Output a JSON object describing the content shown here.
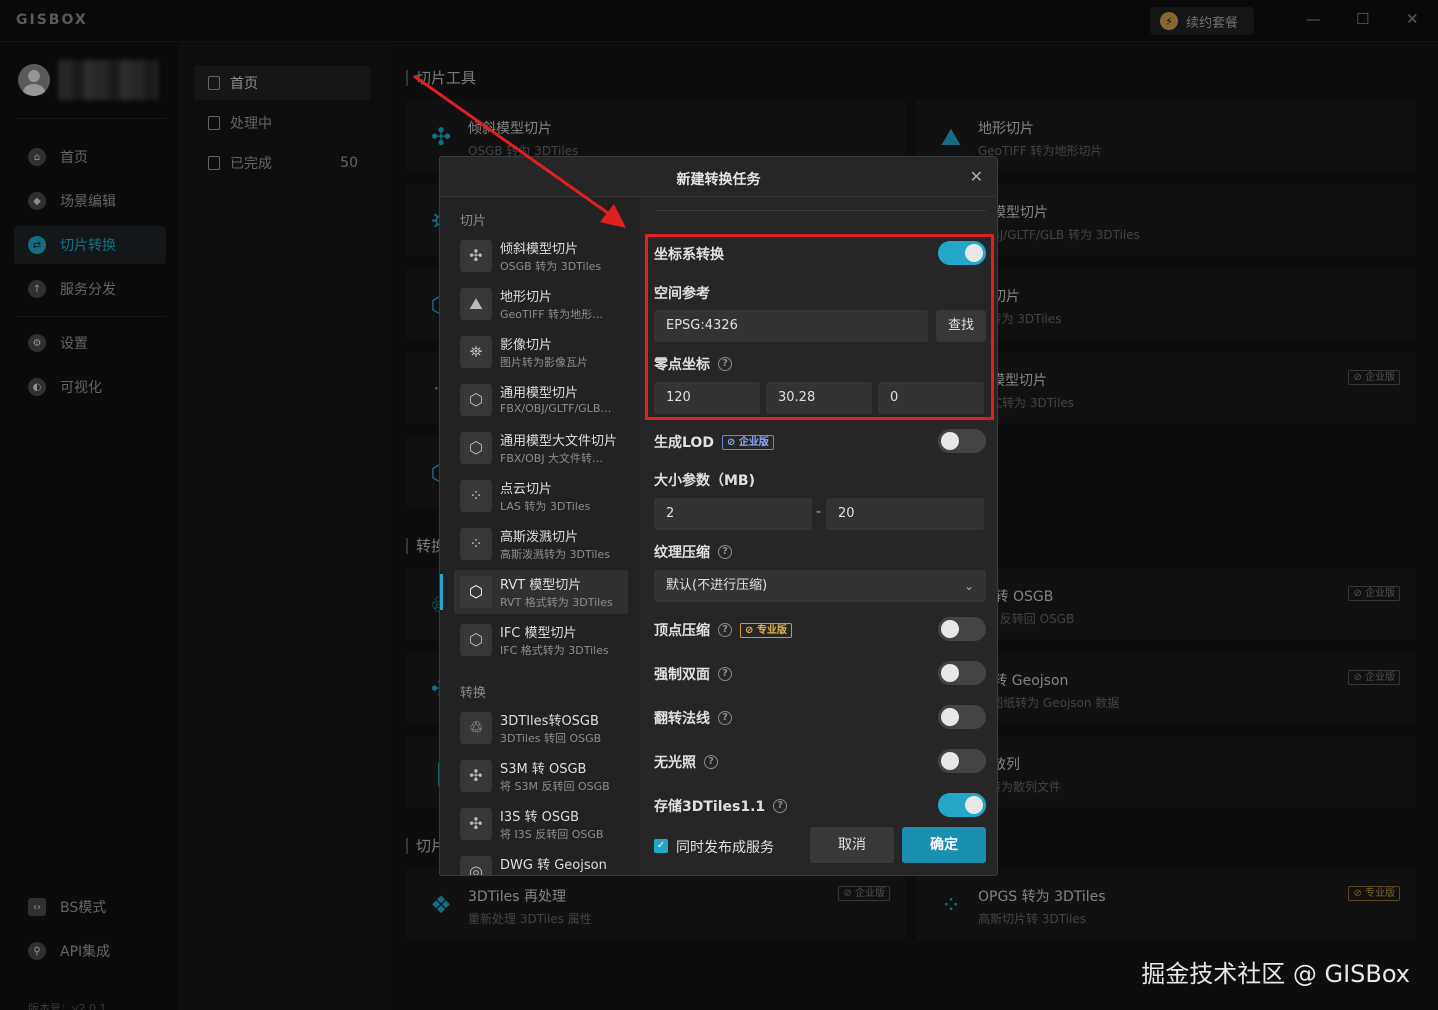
{
  "app": {
    "logo": "GISBOX",
    "renew_label": "续约套餐",
    "min_glyph": "—",
    "max_glyph": "☐",
    "close_glyph": "✕"
  },
  "sidebar": {
    "items": [
      {
        "label": "首页",
        "icon": "home-icon"
      },
      {
        "label": "场景编辑",
        "icon": "cube-icon"
      },
      {
        "label": "切片转换",
        "icon": "convert-icon"
      },
      {
        "label": "服务分发",
        "icon": "upload-icon"
      },
      {
        "label": "设置",
        "icon": "gear-icon"
      },
      {
        "label": "可视化",
        "icon": "chart-icon"
      }
    ],
    "bottom": [
      {
        "label": "BS模式",
        "icon": "code-icon"
      },
      {
        "label": "API集成",
        "icon": "api-icon"
      }
    ],
    "version": "版本号：v2.0.1"
  },
  "subbar": {
    "items": [
      {
        "label": "首页"
      },
      {
        "label": "处理中"
      },
      {
        "label": "已完成",
        "count": "50"
      }
    ]
  },
  "main": {
    "section_slice": "切片工具",
    "section_convert": "转换",
    "section_slice2": "切片",
    "cards": [
      {
        "title": "倾斜模型切片",
        "sub": "OSGB 转为 3DTiles",
        "badge": ""
      },
      {
        "title": "地形切片",
        "sub": "GeoTIFF 转为地形切片",
        "badge": ""
      },
      {
        "title": "用模型切片",
        "sub": "/OBJ/GLTF/GLB 转为 3DTiles",
        "badge": ""
      },
      {
        "title": "云切片",
        "sub": "5 转为 3DTiles",
        "badge": ""
      },
      {
        "title": "T 模型切片",
        "sub": "格式转为 3DTiles",
        "badge": "企业版"
      },
      {
        "title": "M 转 OSGB",
        "sub": "3M 反转回 OSGB",
        "badge": "企业版"
      },
      {
        "title": "G 转 Geojson",
        "sub": "G 图纸转为 Geojson 数据",
        "badge": "企业版"
      },
      {
        "title": "转散列",
        "sub": "P 转为散列文件",
        "badge": ""
      },
      {
        "title": "3DTiles 再处理",
        "sub": "重新处理 3DTiles 属性",
        "badge": "企业版"
      },
      {
        "title": "OPGS 转为 3DTiles",
        "sub": "高斯切片转 3DTiles",
        "badge": "专业版"
      }
    ]
  },
  "dialog": {
    "title": "新建转换任务",
    "group_slice": "切片",
    "group_convert": "转换",
    "tasks": [
      {
        "title": "倾斜模型切片",
        "sub": "OSGB 转为 3DTiles",
        "icon": "drone-icon"
      },
      {
        "title": "地形切片",
        "sub": "GeoTIFF 转为地形…",
        "icon": "terrain-icon"
      },
      {
        "title": "影像切片",
        "sub": "图片转为影像瓦片",
        "icon": "satellite-icon"
      },
      {
        "title": "通用模型切片",
        "sub": "FBX/OBJ/GLTF/GLB…",
        "icon": "box-icon"
      },
      {
        "title": "通用模型大文件切片",
        "sub": "FBX/OBJ 大文件转…",
        "icon": "box-icon"
      },
      {
        "title": "点云切片",
        "sub": "LAS 转为 3DTiles",
        "icon": "pointcloud-icon"
      },
      {
        "title": "高斯泼溅切片",
        "sub": "高斯泼溅转为 3DTiles",
        "icon": "pointcloud-icon"
      },
      {
        "title": "RVT 模型切片",
        "sub": "RVT 格式转为 3DTiles",
        "icon": "box-icon"
      },
      {
        "title": "IFC 模型切片",
        "sub": "IFC 格式转为 3DTiles",
        "icon": "box-icon"
      }
    ],
    "convert_tasks": [
      {
        "title": "3DTIles转OSGB",
        "sub": "3DTiles 转回 OSGB",
        "icon": "recycle-icon"
      },
      {
        "title": "S3M 转 OSGB",
        "sub": "将 S3M 反转回 OSGB",
        "icon": "drone-icon"
      },
      {
        "title": "I3S 转 OSGB",
        "sub": "将 I3S 反转回 OSGB",
        "icon": "drone-icon"
      },
      {
        "title": "DWG 转 Geojson",
        "sub": "",
        "icon": "globe-icon"
      }
    ],
    "form": {
      "coord_label": "坐标系转换",
      "coord_on": true,
      "spatial_ref_label": "空间参考",
      "spatial_ref_value": "EPSG:4326",
      "find_label": "查找",
      "origin_label": "零点坐标",
      "origin_x": "120",
      "origin_y": "30.28",
      "origin_z": "0",
      "lod_label": "生成LOD",
      "lod_badge": "企业版",
      "lod_on": false,
      "size_label": "大小参数（MB)",
      "size_min": "2",
      "size_dash": "-",
      "size_max": "20",
      "texture_label": "纹理压缩",
      "texture_value": "默认(不进行压缩)",
      "vertex_label": "顶点压缩",
      "vertex_badge": "专业版",
      "vertex_on": false,
      "double_label": "强制双面",
      "double_on": false,
      "normal_label": "翻转法线",
      "normal_on": false,
      "unlit_label": "无光照",
      "unlit_on": false,
      "store_label": "存储3DTiles1.1",
      "store_on": true
    },
    "publish_label": "同时发布成服务",
    "cancel_label": "取消",
    "ok_label": "确定"
  },
  "watermark": "掘金技术社区 @ GISBox",
  "colors": {
    "accent": "#22a7c9",
    "highlight": "#e02020"
  }
}
